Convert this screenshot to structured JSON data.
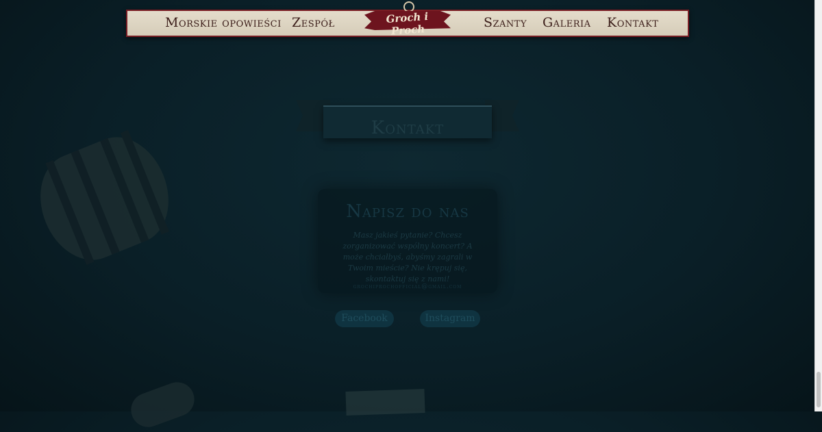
{
  "nav": {
    "items": [
      "Morskie opowieści",
      "Zespół",
      "Szanty",
      "Galeria",
      "Kontakt"
    ],
    "logo_text": "Groch i Proch"
  },
  "section": {
    "title": "Kontakt"
  },
  "card": {
    "heading": "Napisz do nas",
    "body": "Masz jakieś pytanie? Chcesz zorganizować wspólny koncert? A może chciałbyś, abyśmy zagrali w Twoim mieście? Nie krępuj się, skontaktuj się z nami!",
    "email": "grochiprochofficial@gmail.com"
  },
  "social": {
    "facebook": "Facebook",
    "instagram": "Instagram"
  },
  "colors": {
    "nav_bg": "#ddd4c1",
    "accent": "#6d141e",
    "page_bg": "#0a1f27"
  }
}
